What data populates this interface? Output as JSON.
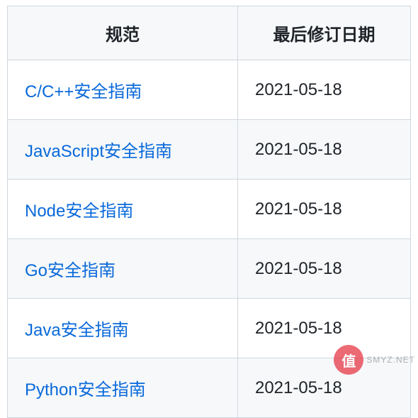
{
  "table": {
    "headers": [
      "规范",
      "最后修订日期"
    ],
    "rows": [
      {
        "name": "C/C++安全指南",
        "date": "2021-05-18"
      },
      {
        "name": "JavaScript安全指南",
        "date": "2021-05-18"
      },
      {
        "name": "Node安全指南",
        "date": "2021-05-18"
      },
      {
        "name": "Go安全指南",
        "date": "2021-05-18"
      },
      {
        "name": "Java安全指南",
        "date": "2021-05-18"
      },
      {
        "name": "Python安全指南",
        "date": "2021-05-18"
      }
    ]
  },
  "watermark": {
    "badge": "值",
    "text": "SMYZ.NET"
  }
}
